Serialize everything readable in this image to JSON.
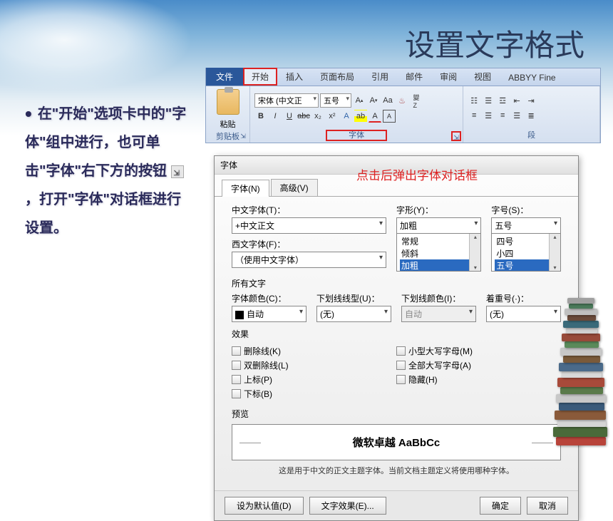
{
  "title": "设置文字格式",
  "description_prefix": "在\"开始\"选项卡中的\"字体\"组中进行，也可单击\"字体\"右下方的按钮",
  "description_suffix": "，打开\"字体\"对话框进行设置。",
  "red_annotation": "点击后弹出字体对话框",
  "ribbon": {
    "tabs": {
      "file": "文件",
      "start": "开始",
      "insert": "插入",
      "layout": "页面布局",
      "ref": "引用",
      "mail": "邮件",
      "review": "审阅",
      "view": "视图",
      "abbyy": "ABBYY Fine"
    },
    "clipboard_label": "剪贴板",
    "paste_label": "粘贴",
    "font_label": "字体",
    "para_label": "段",
    "font_name": "宋体 (中文正",
    "font_size": "五号"
  },
  "dialog": {
    "title": "字体",
    "tab_font": "字体(N)",
    "tab_adv": "高级(V)",
    "labels": {
      "cn_font": "中文字体(T)：",
      "en_font": "西文字体(F)：",
      "style": "字形(Y)：",
      "size": "字号(S)：",
      "all_text": "所有文字",
      "color": "字体颜色(C)：",
      "underline": "下划线线型(U)：",
      "underline_color": "下划线颜色(I)：",
      "emphasis": "着重号(·)：",
      "effects": "效果",
      "preview": "预览"
    },
    "values": {
      "cn_font": "+中文正文",
      "en_font": "（使用中文字体）",
      "style_current": "加粗",
      "size_current": "五号",
      "color": "自动",
      "underline": "(无)",
      "underline_color": "自动",
      "emphasis": "(无)"
    },
    "style_options": [
      "常规",
      "倾斜",
      "加粗"
    ],
    "size_options": [
      "四号",
      "小四",
      "五号"
    ],
    "effects_left": [
      {
        "k": "strike",
        "label": "删除线(K)"
      },
      {
        "k": "dstrike",
        "label": "双删除线(L)"
      },
      {
        "k": "super",
        "label": "上标(P)"
      },
      {
        "k": "sub",
        "label": "下标(B)"
      }
    ],
    "effects_right": [
      {
        "k": "smallcaps",
        "label": "小型大写字母(M)"
      },
      {
        "k": "allcaps",
        "label": "全部大写字母(A)"
      },
      {
        "k": "hidden",
        "label": "隐藏(H)"
      }
    ],
    "preview_text": "微软卓越  AaBbCc",
    "preview_note": "这是用于中文的正文主题字体。当前文档主题定义将使用哪种字体。",
    "buttons": {
      "default": "设为默认值(D)",
      "text_effect": "文字效果(E)...",
      "ok": "确定",
      "cancel": "取消"
    }
  }
}
